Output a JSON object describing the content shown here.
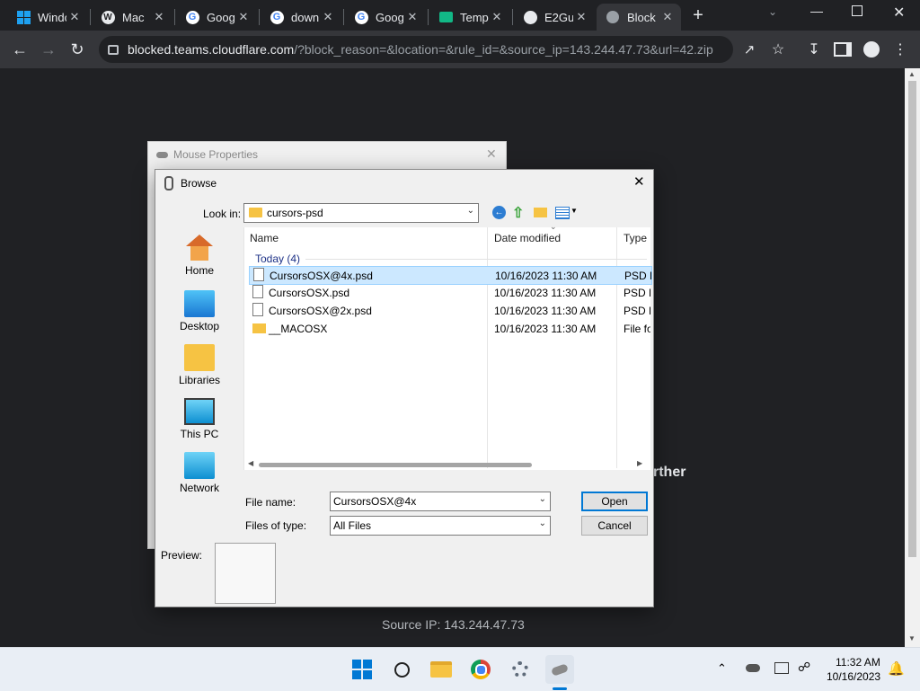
{
  "browser": {
    "tabs": [
      {
        "title": "Windo",
        "favicon": "windows-icon"
      },
      {
        "title": "Mac",
        "favicon": "wordpress-icon"
      },
      {
        "title": "Goog",
        "favicon": "google-icon"
      },
      {
        "title": "down",
        "favicon": "google-icon"
      },
      {
        "title": "Goog",
        "favicon": "google-icon"
      },
      {
        "title": "Temp",
        "favicon": "mail-icon"
      },
      {
        "title": "E2Gu",
        "favicon": "github-icon"
      },
      {
        "title": "Block",
        "favicon": "globe-icon"
      }
    ],
    "url_domain": "blocked.teams.cloudflare.com",
    "url_path": "/?block_reason=&location=&rule_id=&source_ip=143.244.47.73&url=42.zip"
  },
  "page": {
    "partial_text": "rther",
    "source_ip": "Source IP: 143.244.47.73"
  },
  "mouse_properties": {
    "title": "Mouse Properties"
  },
  "browse": {
    "title": "Browse",
    "look_in_label": "Look in:",
    "look_in_value": "cursors-psd",
    "places": [
      "Home",
      "Desktop",
      "Libraries",
      "This PC",
      "Network"
    ],
    "columns": [
      "Name",
      "Date modified",
      "Type"
    ],
    "group": "Today (4)",
    "files": [
      {
        "name": "CursorsOSX@4x.psd",
        "date": "10/16/2023 11:30 AM",
        "type": "PSD F",
        "selected": true,
        "kind": "file"
      },
      {
        "name": "CursorsOSX.psd",
        "date": "10/16/2023 11:30 AM",
        "type": "PSD F",
        "selected": false,
        "kind": "file"
      },
      {
        "name": "CursorsOSX@2x.psd",
        "date": "10/16/2023 11:30 AM",
        "type": "PSD F",
        "selected": false,
        "kind": "file"
      },
      {
        "name": "__MACOSX",
        "date": "10/16/2023 11:30 AM",
        "type": "File fo",
        "selected": false,
        "kind": "folder"
      }
    ],
    "file_name_label": "File name:",
    "file_name_value": "CursorsOSX@4x",
    "files_of_type_label": "Files of type:",
    "files_of_type_value": "All Files",
    "open_label": "Open",
    "cancel_label": "Cancel",
    "preview_label": "Preview:"
  },
  "taskbar": {
    "time": "11:32 AM",
    "date": "10/16/2023"
  },
  "colors": {
    "selection": "#cce8ff",
    "chrome_dark": "#202124",
    "accent": "#0078d4"
  }
}
